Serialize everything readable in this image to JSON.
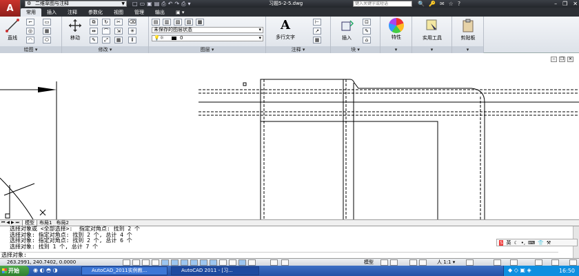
{
  "titlebar": {
    "workspace": "二维草图与注释",
    "document_title": "习题5-2-5.dwg",
    "search_placeholder": "键入关键字或短语"
  },
  "ribbon": {
    "tabs": [
      "常用",
      "插入",
      "注释",
      "参数化",
      "视图",
      "管理",
      "输出"
    ],
    "active_tab": "常用",
    "panels": {
      "draw": {
        "title": "绘图",
        "line_label": "直线"
      },
      "modify": {
        "title": "修改",
        "move_label": "移动"
      },
      "layers": {
        "title": "图层",
        "state": "未保存的图层状态",
        "current_layer": "0"
      },
      "annotation": {
        "title": "注释",
        "mtext_label": "多行文字"
      },
      "block": {
        "title": "块",
        "insert_label": "插入"
      },
      "properties": {
        "label": "特性"
      },
      "utilities": {
        "label": "实用工具"
      },
      "clipboard": {
        "label": "剪贴板"
      }
    }
  },
  "layout_tabs": [
    "模型",
    "布局1",
    "布局2"
  ],
  "command": {
    "history": [
      "选择对象或 <全部选择>:  指定对角点: 找到 2 个",
      "选择对象: 指定对角点: 找到 2 个, 总计 4 个",
      "选择对象: 指定对角点: 找到 2 个, 总计 6 个",
      "选择对象: 找到 1 个, 总计 7 个"
    ],
    "prompt": "选择对象:"
  },
  "ime": {
    "label": "英"
  },
  "status": {
    "coords": "263.2991, 240.7402, 0.0000",
    "model": "模型",
    "scale": "1:1"
  },
  "taskbar": {
    "start": "开始",
    "tasks": [
      "AutoCAD_2011实例教...",
      "AutoCAD 2011 - [习..."
    ],
    "clock": "16:50"
  }
}
